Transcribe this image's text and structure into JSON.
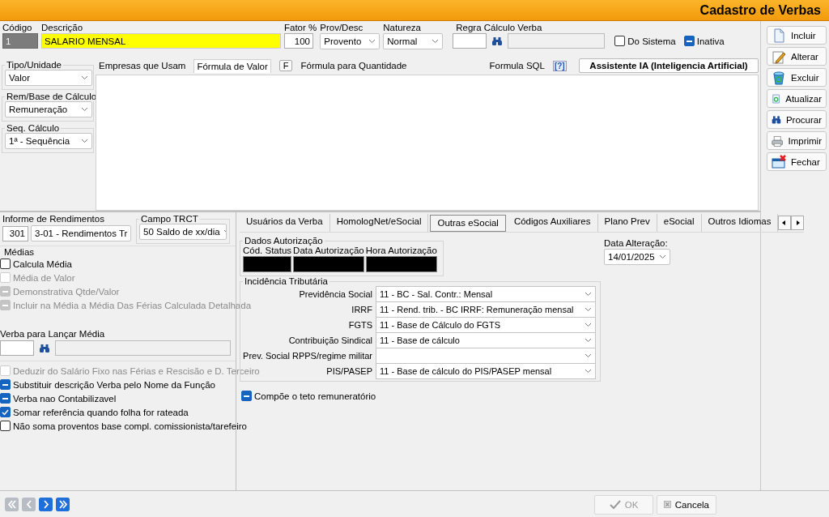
{
  "header": {
    "title": "Cadastro de Verbas"
  },
  "top": {
    "codigo": {
      "label": "Código",
      "value": "1"
    },
    "descricao": {
      "label": "Descrição",
      "value": "SALARIO MENSAL"
    },
    "fator": {
      "label": "Fator %",
      "value": "100"
    },
    "prov_desc": {
      "label": "Prov/Desc",
      "value": "Provento"
    },
    "natureza": {
      "label": "Natureza",
      "value": "Normal"
    },
    "regra": {
      "label": "Regra Cálculo Verba"
    },
    "checks": [
      {
        "label": "Do Sistema",
        "checked": false,
        "indeterminate": false,
        "disabled": false
      },
      {
        "label": "Inativa",
        "checked": true,
        "indeterminate": true,
        "disabled": false
      }
    ]
  },
  "side_buttons": [
    {
      "label": "Incluir"
    },
    {
      "label": "Alterar"
    },
    {
      "label": "Excluir"
    },
    {
      "label": "Atualizar"
    },
    {
      "label": "Procurar"
    },
    {
      "label": "Imprimir"
    },
    {
      "label": "Fechar"
    }
  ],
  "left_groups": [
    {
      "title": "Tipo/Unidade",
      "value": "Valor"
    },
    {
      "title": "Rem/Base de Cálculo",
      "value": "Remuneração"
    },
    {
      "title": "Seq. Cálculo",
      "value": "1ª - Sequência"
    }
  ],
  "formula_tabs": [
    {
      "label": "Empresas que Usam",
      "selected": false,
      "kind": "tab"
    },
    {
      "label": "Fórmula de Valor",
      "selected": true,
      "kind": "tab"
    },
    {
      "label": "F",
      "selected": false,
      "kind": "key"
    },
    {
      "label": "Fórmula para Quantidade",
      "selected": false,
      "kind": "tab"
    },
    {
      "label": "Formula SQL",
      "selected": false,
      "kind": "tab"
    },
    {
      "label": "[?]",
      "selected": false,
      "kind": "help"
    }
  ],
  "assistant_button": "Assistente IA (Inteligencia Artificial)",
  "informe": {
    "title": "Informe de Rendimentos",
    "code": "301",
    "value": "3-01 - Rendimentos Tr"
  },
  "campo_trct": {
    "title": "Campo TRCT",
    "value": "50 Saldo de xx/dia"
  },
  "medias": {
    "title": "Médias",
    "checks": [
      {
        "label": "Calcula Média",
        "checked": false,
        "indeterminate": false,
        "disabled": false
      },
      {
        "label": "Média de Valor",
        "checked": false,
        "indeterminate": false,
        "disabled": true
      },
      {
        "label": "Demonstrativa Qtde/Valor",
        "checked": true,
        "indeterminate": true,
        "disabled": true
      },
      {
        "label": "Incluir na Média a Média Das Férias Calculada Detalhada",
        "checked": true,
        "indeterminate": true,
        "disabled": true
      }
    ]
  },
  "verba_media": {
    "label": "Verba para Lançar Média"
  },
  "options": [
    {
      "label": "Deduzir do Salário Fixo nas  Férias e Rescisão e D. Terceiro",
      "checked": false,
      "indeterminate": false,
      "disabled": true
    },
    {
      "label": "Substituir descrição Verba pelo Nome da Função",
      "checked": true,
      "indeterminate": true,
      "disabled": false
    },
    {
      "label": "Verba nao Contabilizavel",
      "checked": true,
      "indeterminate": true,
      "disabled": false
    },
    {
      "label": "Somar referência quando folha for rateada",
      "checked": true,
      "indeterminate": false,
      "disabled": false
    },
    {
      "label": "Não soma proventos base compl. comissionista/tarefeiro",
      "checked": false,
      "indeterminate": false,
      "disabled": false
    }
  ],
  "tabs": [
    {
      "label": "Usuários da Verba",
      "selected": false
    },
    {
      "label": "HomologNet/eSocial",
      "selected": false
    },
    {
      "label": "Outras eSocial",
      "selected": true
    },
    {
      "label": "Códigos Auxiliares",
      "selected": false
    },
    {
      "label": "Plano Prev",
      "selected": false
    },
    {
      "label": "eSocial",
      "selected": false
    },
    {
      "label": "Outros Idiomas",
      "selected": false
    }
  ],
  "dados_autorizacao": {
    "title": "Dados Autorização",
    "fields": [
      {
        "label": "Cód. Status"
      },
      {
        "label": "Data Autorização"
      },
      {
        "label": "Hora Autorização"
      }
    ]
  },
  "data_alteracao": {
    "label": "Data Alteração:",
    "value": "14/01/2025"
  },
  "incidencia": {
    "title": "Incidência Tributária",
    "rows": [
      {
        "label": "Previdência Social",
        "value": "11 - BC - Sal. Contr.: Mensal"
      },
      {
        "label": "IRRF",
        "value": "11 - Rend. trib. - BC IRRF: Remuneração mensal"
      },
      {
        "label": "FGTS",
        "value": "11 - Base de Cálculo do FGTS"
      },
      {
        "label": "Contribuição Sindical",
        "value": "11 - Base de cálculo"
      },
      {
        "label": "Prev. Social RPPS/regime militar"
      },
      {
        "label": "PIS/PASEP",
        "value": "11 - Base de cálculo do PIS/PASEP mensal"
      }
    ]
  },
  "compoe": {
    "label": "Compõe o teto remuneratório",
    "checked": true,
    "indeterminate": true,
    "disabled": false
  },
  "nav": [
    {
      "disabled": true
    },
    {
      "disabled": true
    },
    {
      "disabled": false
    },
    {
      "disabled": false
    }
  ],
  "footer_buttons": [
    {
      "label": "OK",
      "disabled": true
    },
    {
      "label": "Cancela",
      "disabled": false
    }
  ]
}
